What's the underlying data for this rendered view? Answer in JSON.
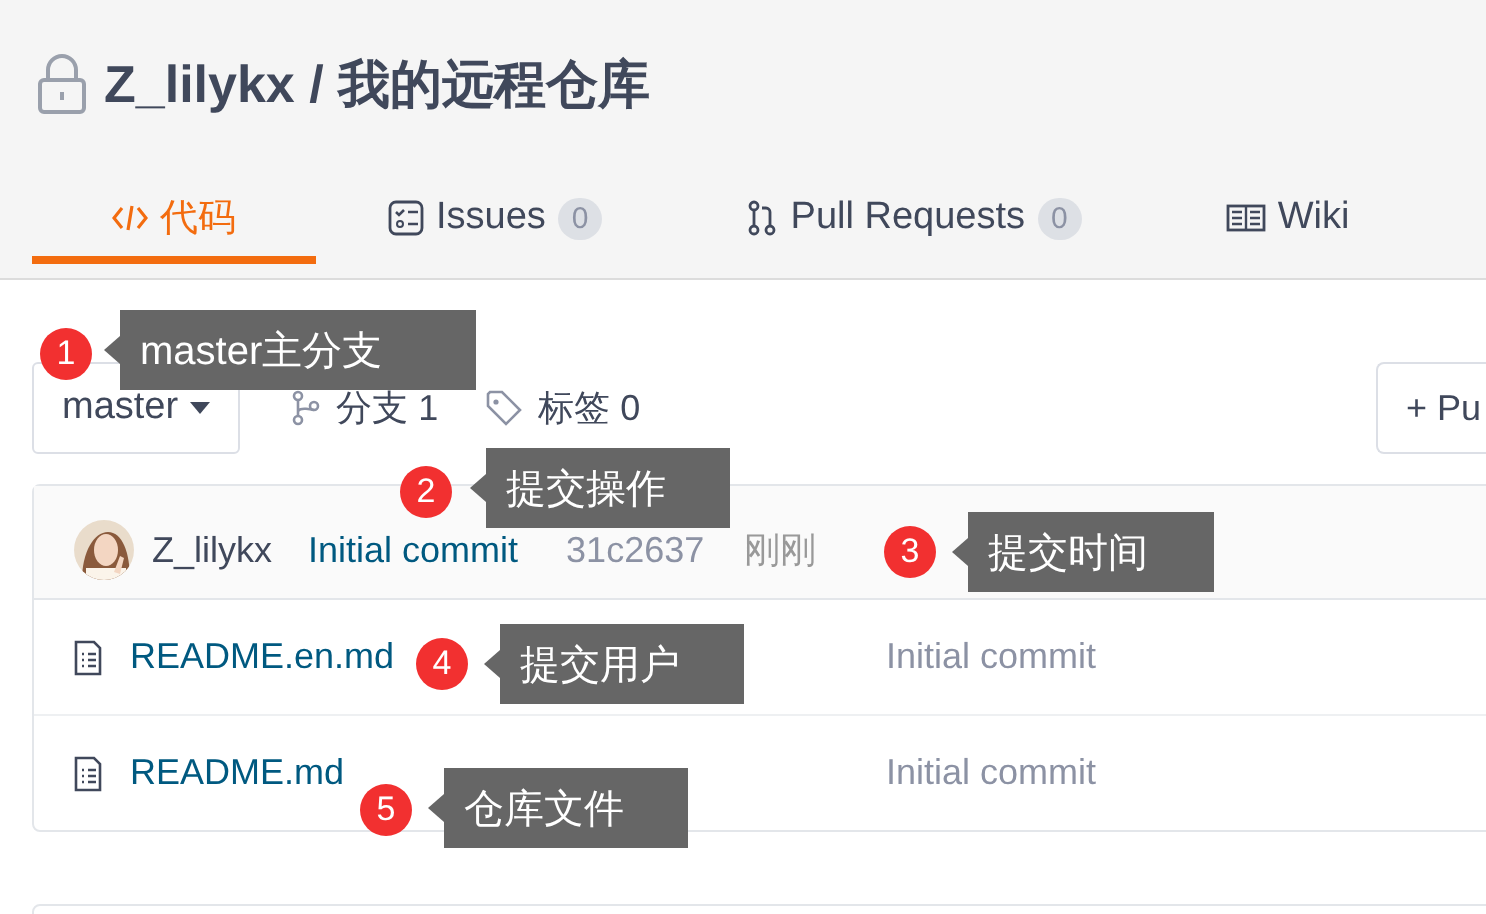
{
  "repo": {
    "title": "Z_lilykx / 我的远程仓库"
  },
  "tabs": [
    {
      "label": "代码",
      "selected": true
    },
    {
      "label": "Issues",
      "count": "0",
      "selected": false
    },
    {
      "label": "Pull Requests",
      "count": "0",
      "selected": false
    },
    {
      "label": "Wiki",
      "selected": false
    }
  ],
  "branch_select": {
    "value": "master"
  },
  "branches": {
    "label": "分支 1"
  },
  "tags": {
    "label": "标签 0"
  },
  "action_button": {
    "label": "+ Pu"
  },
  "commit": {
    "author": "Z_lilykx",
    "message": "Initial commit",
    "hash": "31c2637",
    "time": "刚刚"
  },
  "files": [
    {
      "name": "README.en.md",
      "message": "Initial commit"
    },
    {
      "name": "README.md",
      "message": "Initial commit"
    }
  ],
  "annotations": [
    {
      "number": "1",
      "label": "master主分支"
    },
    {
      "number": "2",
      "label": "提交操作"
    },
    {
      "number": "3",
      "label": "提交时间"
    },
    {
      "number": "4",
      "label": "提交用户"
    },
    {
      "number": "5",
      "label": "仓库文件"
    }
  ]
}
